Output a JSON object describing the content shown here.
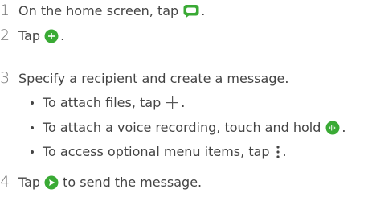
{
  "colors": {
    "accent": "#3aaa35",
    "text": "#444444",
    "number": "#777777"
  },
  "steps": [
    {
      "number": "1",
      "text": "On the home screen, tap",
      "icon": "messaging-app-icon",
      "after": "."
    },
    {
      "number": "2",
      "text": "Tap",
      "icon": "new-message-icon",
      "after": "."
    },
    {
      "number": "3",
      "text": "Specify a recipient and create a message."
    },
    {
      "number": "4",
      "text": "Tap",
      "icon": "send-icon",
      "after": "to send the message."
    }
  ],
  "bullets": [
    {
      "text": "To attach files, tap",
      "icon": "attach-plus-icon",
      "after": "."
    },
    {
      "text": "To attach a voice recording, touch and hold",
      "icon": "voice-recording-icon",
      "after": "."
    },
    {
      "text": "To access optional menu items, tap",
      "icon": "more-options-icon",
      "after": "."
    }
  ]
}
